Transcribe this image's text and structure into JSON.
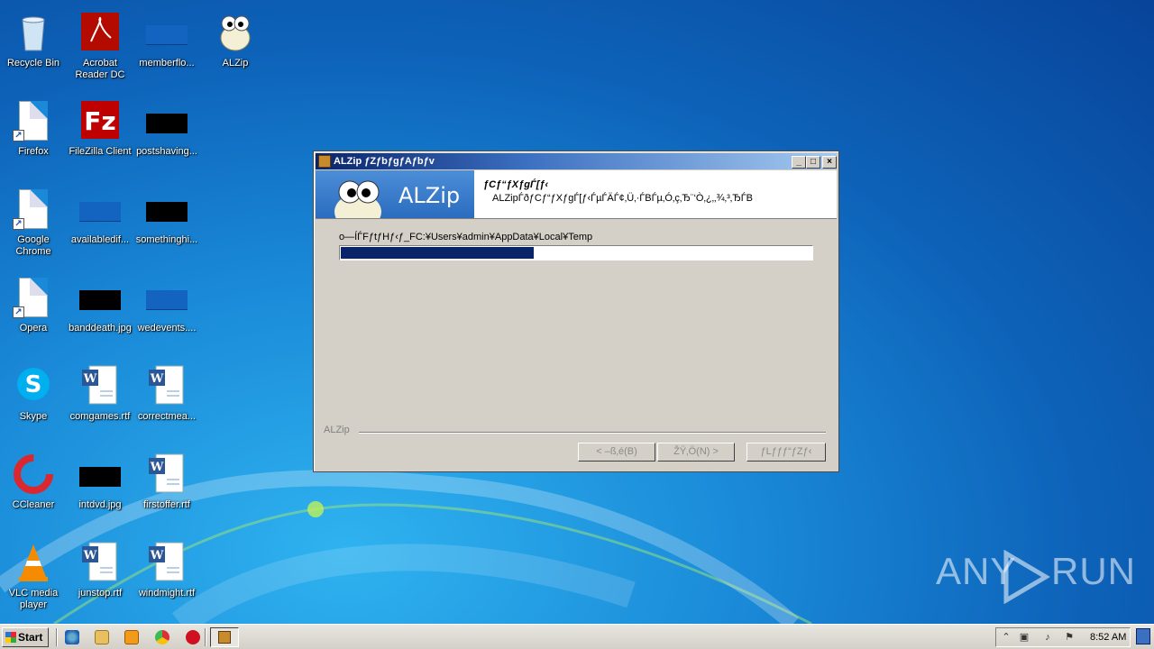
{
  "desktop_icons": [
    {
      "label": "Recycle Bin",
      "icon": "recycle-bin-icon"
    },
    {
      "label": "Acrobat Reader DC",
      "icon": "acrobat-reader-icon"
    },
    {
      "label": "memberflo...",
      "icon": "file-icon"
    },
    {
      "label": "ALZip",
      "icon": "alzip-icon"
    },
    {
      "label": "Firefox",
      "icon": "firefox-icon"
    },
    {
      "label": "FileZilla Client",
      "icon": "filezilla-icon"
    },
    {
      "label": "postshaving...",
      "icon": "file-icon"
    },
    {
      "label": "Google Chrome",
      "icon": "chrome-icon"
    },
    {
      "label": "availabledif...",
      "icon": "file-icon"
    },
    {
      "label": "somethinghi...",
      "icon": "file-icon"
    },
    {
      "label": "Opera",
      "icon": "opera-icon"
    },
    {
      "label": "banddeath.jpg",
      "icon": "image-file-icon"
    },
    {
      "label": "wedevents....",
      "icon": "file-icon"
    },
    {
      "label": "Skype",
      "icon": "skype-icon"
    },
    {
      "label": "comgames.rtf",
      "icon": "word-document-icon"
    },
    {
      "label": "correctmea...",
      "icon": "word-document-icon"
    },
    {
      "label": "CCleaner",
      "icon": "ccleaner-icon"
    },
    {
      "label": "intdvd.jpg",
      "icon": "image-file-icon"
    },
    {
      "label": "firstoffer.rtf",
      "icon": "word-document-icon"
    },
    {
      "label": "VLC media player",
      "icon": "vlc-icon"
    },
    {
      "label": "junstop.rtf",
      "icon": "word-document-icon"
    },
    {
      "label": "windmight.rtf",
      "icon": "word-document-icon"
    }
  ],
  "window": {
    "title": "ALZip ƒZƒbƒgƒAƒbƒv",
    "header_title": "ƒCƒ“ƒXƒgЃ[ƒ‹",
    "header_subtitle": "ALZipЃðƒCƒ“ƒXƒgЃ[ƒ‹ЃµЃÄЃ¢‚Ü‚·ЃBЃµ‚Ó‚ç‚­Ђ¨‘Ò‚¿‚­‚¾‚³‚ЂЃB",
    "banner_brand": "ALZip",
    "path_label": "o—ÍЃFƒtƒHƒ‹ƒ_FC:¥Users¥admin¥AppData¥Local¥Temp",
    "progress": 0.41,
    "footer_label": "ALZip",
    "back_button": "< –ß‚é(B)",
    "next_button": "ŽŸ‚Ö(N) >",
    "cancel_button": "ƒLƒƒƒ“ƒZƒ‹",
    "minimize": "_",
    "maximize": "□",
    "close": "×"
  },
  "watermark": {
    "left": "ANY",
    "right": "RUN"
  },
  "taskbar": {
    "start_label": "Start",
    "clock": "8:52 AM",
    "quick_launch": [
      "ie-icon",
      "folder-icon",
      "media-player-icon",
      "chrome-icon",
      "opera-icon"
    ]
  }
}
